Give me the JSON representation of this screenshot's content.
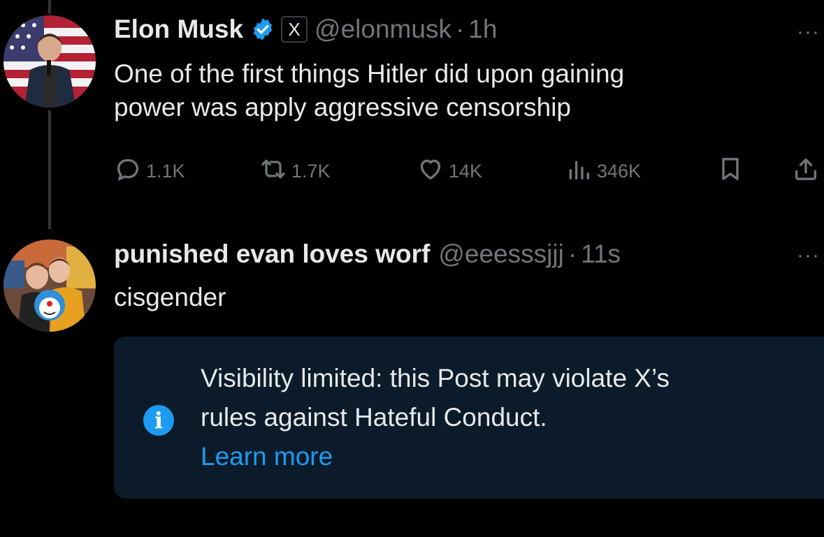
{
  "posts": [
    {
      "name": "Elon Musk",
      "affiliate_badge": "X",
      "handle": "@elonmusk",
      "separator": "·",
      "time": "1h",
      "more": "···",
      "text_line1": "One of the first things Hitler did upon gaining",
      "text_line2": "power was apply aggressive censorship",
      "metrics": {
        "replies": "1.1K",
        "reposts": "1.7K",
        "likes": "14K",
        "views": "346K"
      }
    },
    {
      "name": "punished evan loves worf",
      "handle": "@eeesssjjj",
      "separator": "·",
      "time": "11s",
      "more": "···",
      "text": "cisgender"
    }
  ],
  "notice": {
    "line1": "Visibility limited: this Post may violate X’s",
    "line2": "rules against Hateful Conduct.",
    "link": "Learn more",
    "icon": "info-icon"
  },
  "colors": {
    "background": "#000000",
    "text": "#e7e9ea",
    "muted": "#71767b",
    "accent": "#1d9bf0",
    "notice_bg": "#0b1b2a"
  },
  "icons": {
    "verified": "verified-badge-icon",
    "reply": "reply-icon",
    "repost": "repost-icon",
    "like": "heart-icon",
    "views": "views-icon",
    "bookmark": "bookmark-icon",
    "share": "share-icon"
  }
}
